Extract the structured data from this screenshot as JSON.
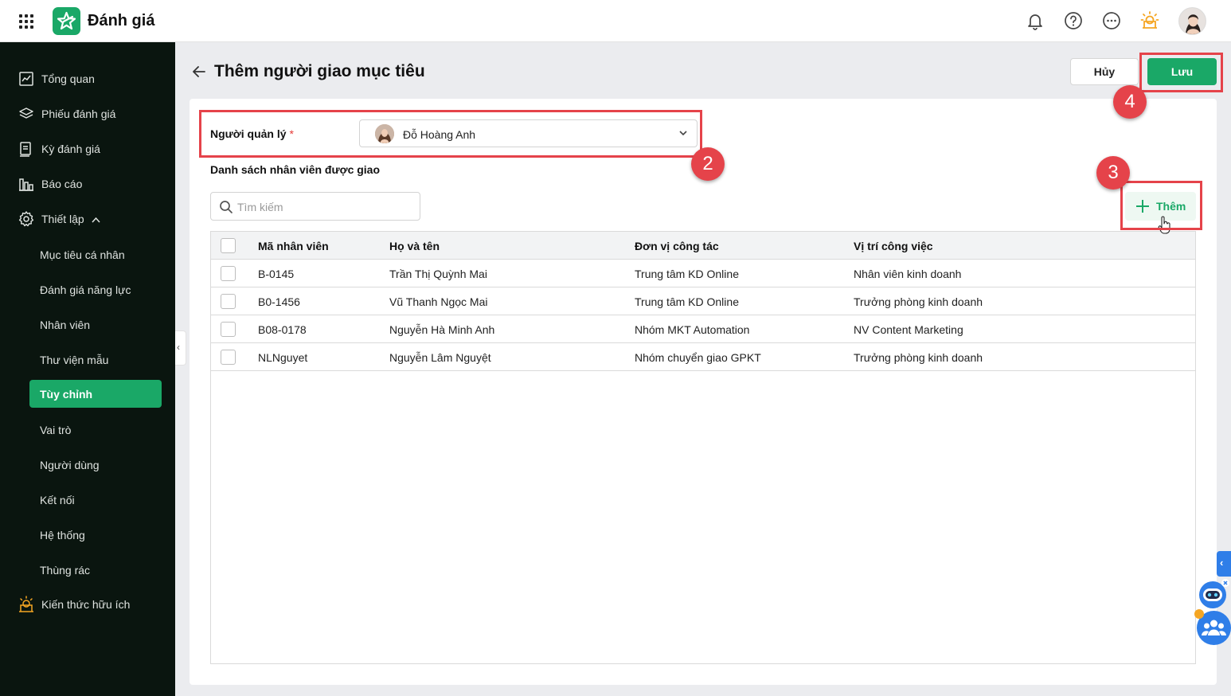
{
  "app": {
    "title": "Đánh giá"
  },
  "colors": {
    "brand": "#1aa867",
    "sidebar_bg": "#0a150f",
    "annotation": "#e5434a",
    "widget": "#2f7ee8"
  },
  "topbar": {
    "icons": [
      "apps-grid-icon",
      "bell-icon",
      "help-icon",
      "more-icon",
      "lightbulb-icon",
      "user-avatar"
    ]
  },
  "sidebar": {
    "items": [
      {
        "label": "Tổng quan",
        "icon": "chart-line-icon"
      },
      {
        "label": "Phiếu đánh giá",
        "icon": "layers-icon"
      },
      {
        "label": "Kỳ đánh giá",
        "icon": "clipboard-icon"
      },
      {
        "label": "Báo cáo",
        "icon": "bar-chart-icon"
      },
      {
        "label": "Thiết lập",
        "icon": "gear-icon",
        "expanded": true
      },
      {
        "label": "Kiến thức hữu ích",
        "icon": "bulb-icon"
      }
    ],
    "sub_items": [
      {
        "label": "Mục tiêu cá nhân"
      },
      {
        "label": "Đánh giá năng lực"
      },
      {
        "label": "Nhân viên"
      },
      {
        "label": "Thư viện mẫu"
      },
      {
        "label": "Tùy chỉnh",
        "active": true
      },
      {
        "label": "Vai trò"
      },
      {
        "label": "Người dùng"
      },
      {
        "label": "Kết nối"
      },
      {
        "label": "Hệ thống"
      },
      {
        "label": "Thùng rác"
      }
    ]
  },
  "header": {
    "title": "Thêm người giao mục tiêu",
    "cancel_label": "Hủy",
    "save_label": "Lưu"
  },
  "form": {
    "manager_label": "Người quản lý",
    "required_mark": "*",
    "manager_value": "Đỗ Hoàng Anh",
    "list_title": "Danh sách nhân viên được giao",
    "search_placeholder": "Tìm kiếm",
    "add_label": "Thêm"
  },
  "table": {
    "columns": [
      "Mã nhân viên",
      "Họ và tên",
      "Đơn vị công tác",
      "Vị trí công việc"
    ],
    "rows": [
      [
        "B-0145",
        "Trần Thị Quỳnh Mai",
        "Trung tâm KD Online",
        "Nhân viên kinh doanh"
      ],
      [
        "B0-1456",
        "Vũ Thanh Ngọc Mai",
        "Trung tâm KD Online",
        "Trưởng phòng kinh doanh"
      ],
      [
        "B08-0178",
        "Nguyễn Hà Minh Anh",
        "Nhóm MKT Automation",
        "NV Content Marketing"
      ],
      [
        "NLNguyet",
        "Nguyễn Lâm Nguyệt",
        "Nhóm chuyển giao GPKT",
        "Trưởng phòng kinh doanh"
      ]
    ]
  },
  "annotations": {
    "badges": [
      "2",
      "3",
      "4"
    ]
  }
}
